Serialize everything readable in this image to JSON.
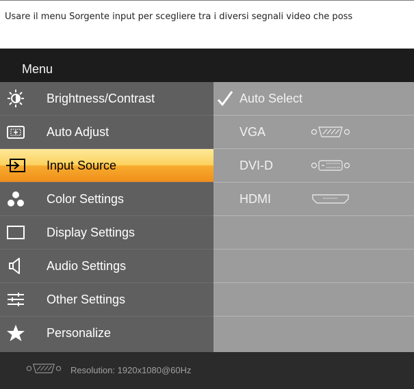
{
  "intro_text": "Usare il menu Sorgente input per scegliere tra i diversi segnali video che poss",
  "osd": {
    "title": "Menu",
    "menu_items": [
      {
        "label": "Brightness/Contrast",
        "icon": "brightness-icon"
      },
      {
        "label": "Auto Adjust",
        "icon": "auto-adjust-icon"
      },
      {
        "label": "Input Source",
        "icon": "input-source-icon",
        "selected": true
      },
      {
        "label": "Color Settings",
        "icon": "color-settings-icon"
      },
      {
        "label": "Display Settings",
        "icon": "display-settings-icon"
      },
      {
        "label": "Audio Settings",
        "icon": "speaker-icon"
      },
      {
        "label": "Other Settings",
        "icon": "sliders-icon"
      },
      {
        "label": "Personalize",
        "icon": "star-icon"
      }
    ],
    "source_options": [
      {
        "label": "Auto Select",
        "checked": true,
        "connector": null
      },
      {
        "label": "VGA",
        "checked": false,
        "connector": "vga-connector-icon"
      },
      {
        "label": "DVI-D",
        "checked": false,
        "connector": "dvi-connector-icon"
      },
      {
        "label": "HDMI",
        "checked": false,
        "connector": "hdmi-connector-icon"
      }
    ],
    "status": {
      "connector": "vga-connector-icon",
      "text": "Resolution: 1920x1080@60Hz"
    },
    "colors": {
      "title_bg": "#1c1c1c",
      "menu_bg": "#5f5f5f",
      "options_bg": "#9c9c9c",
      "highlight_top": "#fde89a",
      "highlight_bottom": "#f08f1a",
      "status_bg": "#2b2b2b"
    }
  }
}
